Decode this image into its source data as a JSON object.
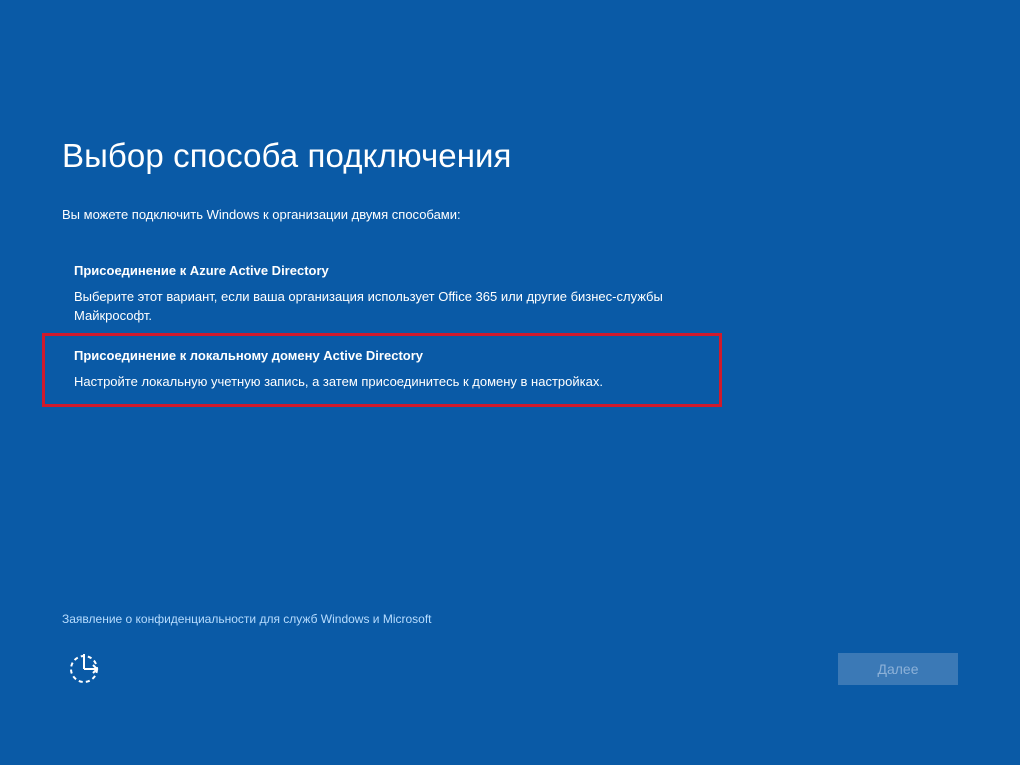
{
  "page": {
    "title": "Выбор способа подключения",
    "subtitle": "Вы можете подключить Windows к организации двумя способами:"
  },
  "options": [
    {
      "title": "Присоединение к Azure Active Directory",
      "description": "Выберите этот вариант, если ваша организация использует Office 365 или другие бизнес-службы Майкрософт."
    },
    {
      "title": "Присоединение к локальному домену Active Directory",
      "description": "Настройте локальную учетную запись, а затем присоединитесь к домену в настройках."
    }
  ],
  "footer": {
    "privacy_link": "Заявление о конфиденциальности для служб Windows и Microsoft",
    "accessibility_icon": "ease-of-access-icon",
    "next_label": "Далее"
  },
  "colors": {
    "background": "#0a5aa6",
    "highlight_border": "#d01a2c",
    "link": "#b6dcff",
    "button_disabled_bg": "#3b79b6",
    "button_disabled_text": "#8cb1d8"
  }
}
